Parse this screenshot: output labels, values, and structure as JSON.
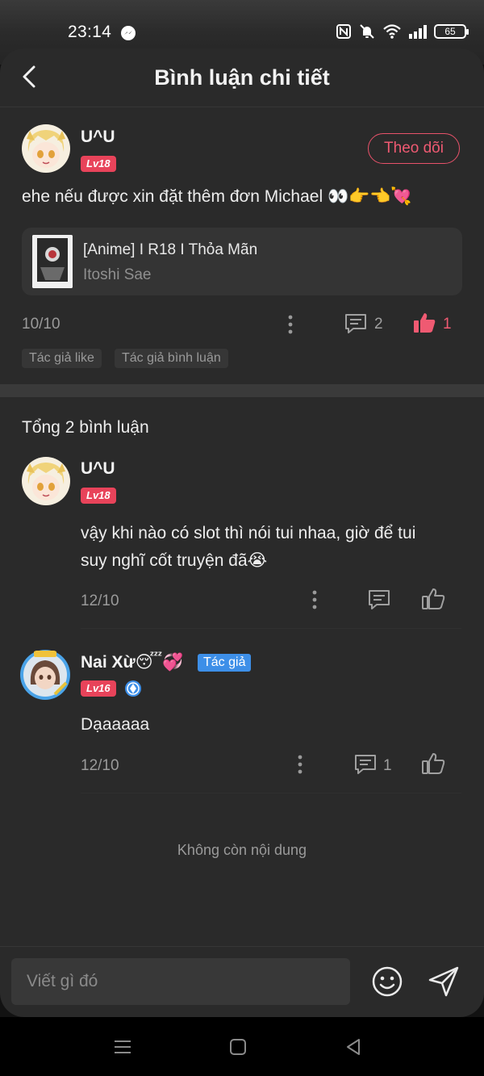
{
  "status_bar": {
    "time": "23:14",
    "battery": "65",
    "icons": [
      "messenger-icon",
      "nfc-icon",
      "mute-icon",
      "wifi-icon",
      "signal-icon",
      "battery-icon"
    ]
  },
  "header": {
    "title": "Bình luận chi tiết"
  },
  "main_comment": {
    "username": "U^U",
    "level": "Lv18",
    "follow_label": "Theo dõi",
    "text": "ehe nếu được xin đặt thêm đơn Michael 👀👉👈💘",
    "book": {
      "title": "[Anime] I R18 I Thỏa Mãn",
      "author": "Itoshi Sae"
    },
    "date": "10/10",
    "reply_count": "2",
    "like_count": "1",
    "tags": [
      "Tác giả like",
      "Tác giả bình luận"
    ]
  },
  "total_label": "Tổng 2 bình luận",
  "replies": [
    {
      "username": "U^U",
      "level": "Lv18",
      "text_line1": "vậy khi nào có slot thì nói tui nhaa, giờ để tui",
      "text_line2": "suy nghĩ cốt truyện đã😭",
      "date": "12/10"
    },
    {
      "username": "Nai Xừ😴💞",
      "author_badge": "Tác giả",
      "level": "Lv16",
      "text": "Dạaaaaa",
      "date": "12/10",
      "reply_count": "1"
    }
  ],
  "end_label": "Không còn nội dung",
  "input": {
    "placeholder": "Viết gì đó"
  },
  "colors": {
    "accent": "#e8435a",
    "background": "#2a2a2a",
    "author_badge": "#3d8fe8"
  }
}
